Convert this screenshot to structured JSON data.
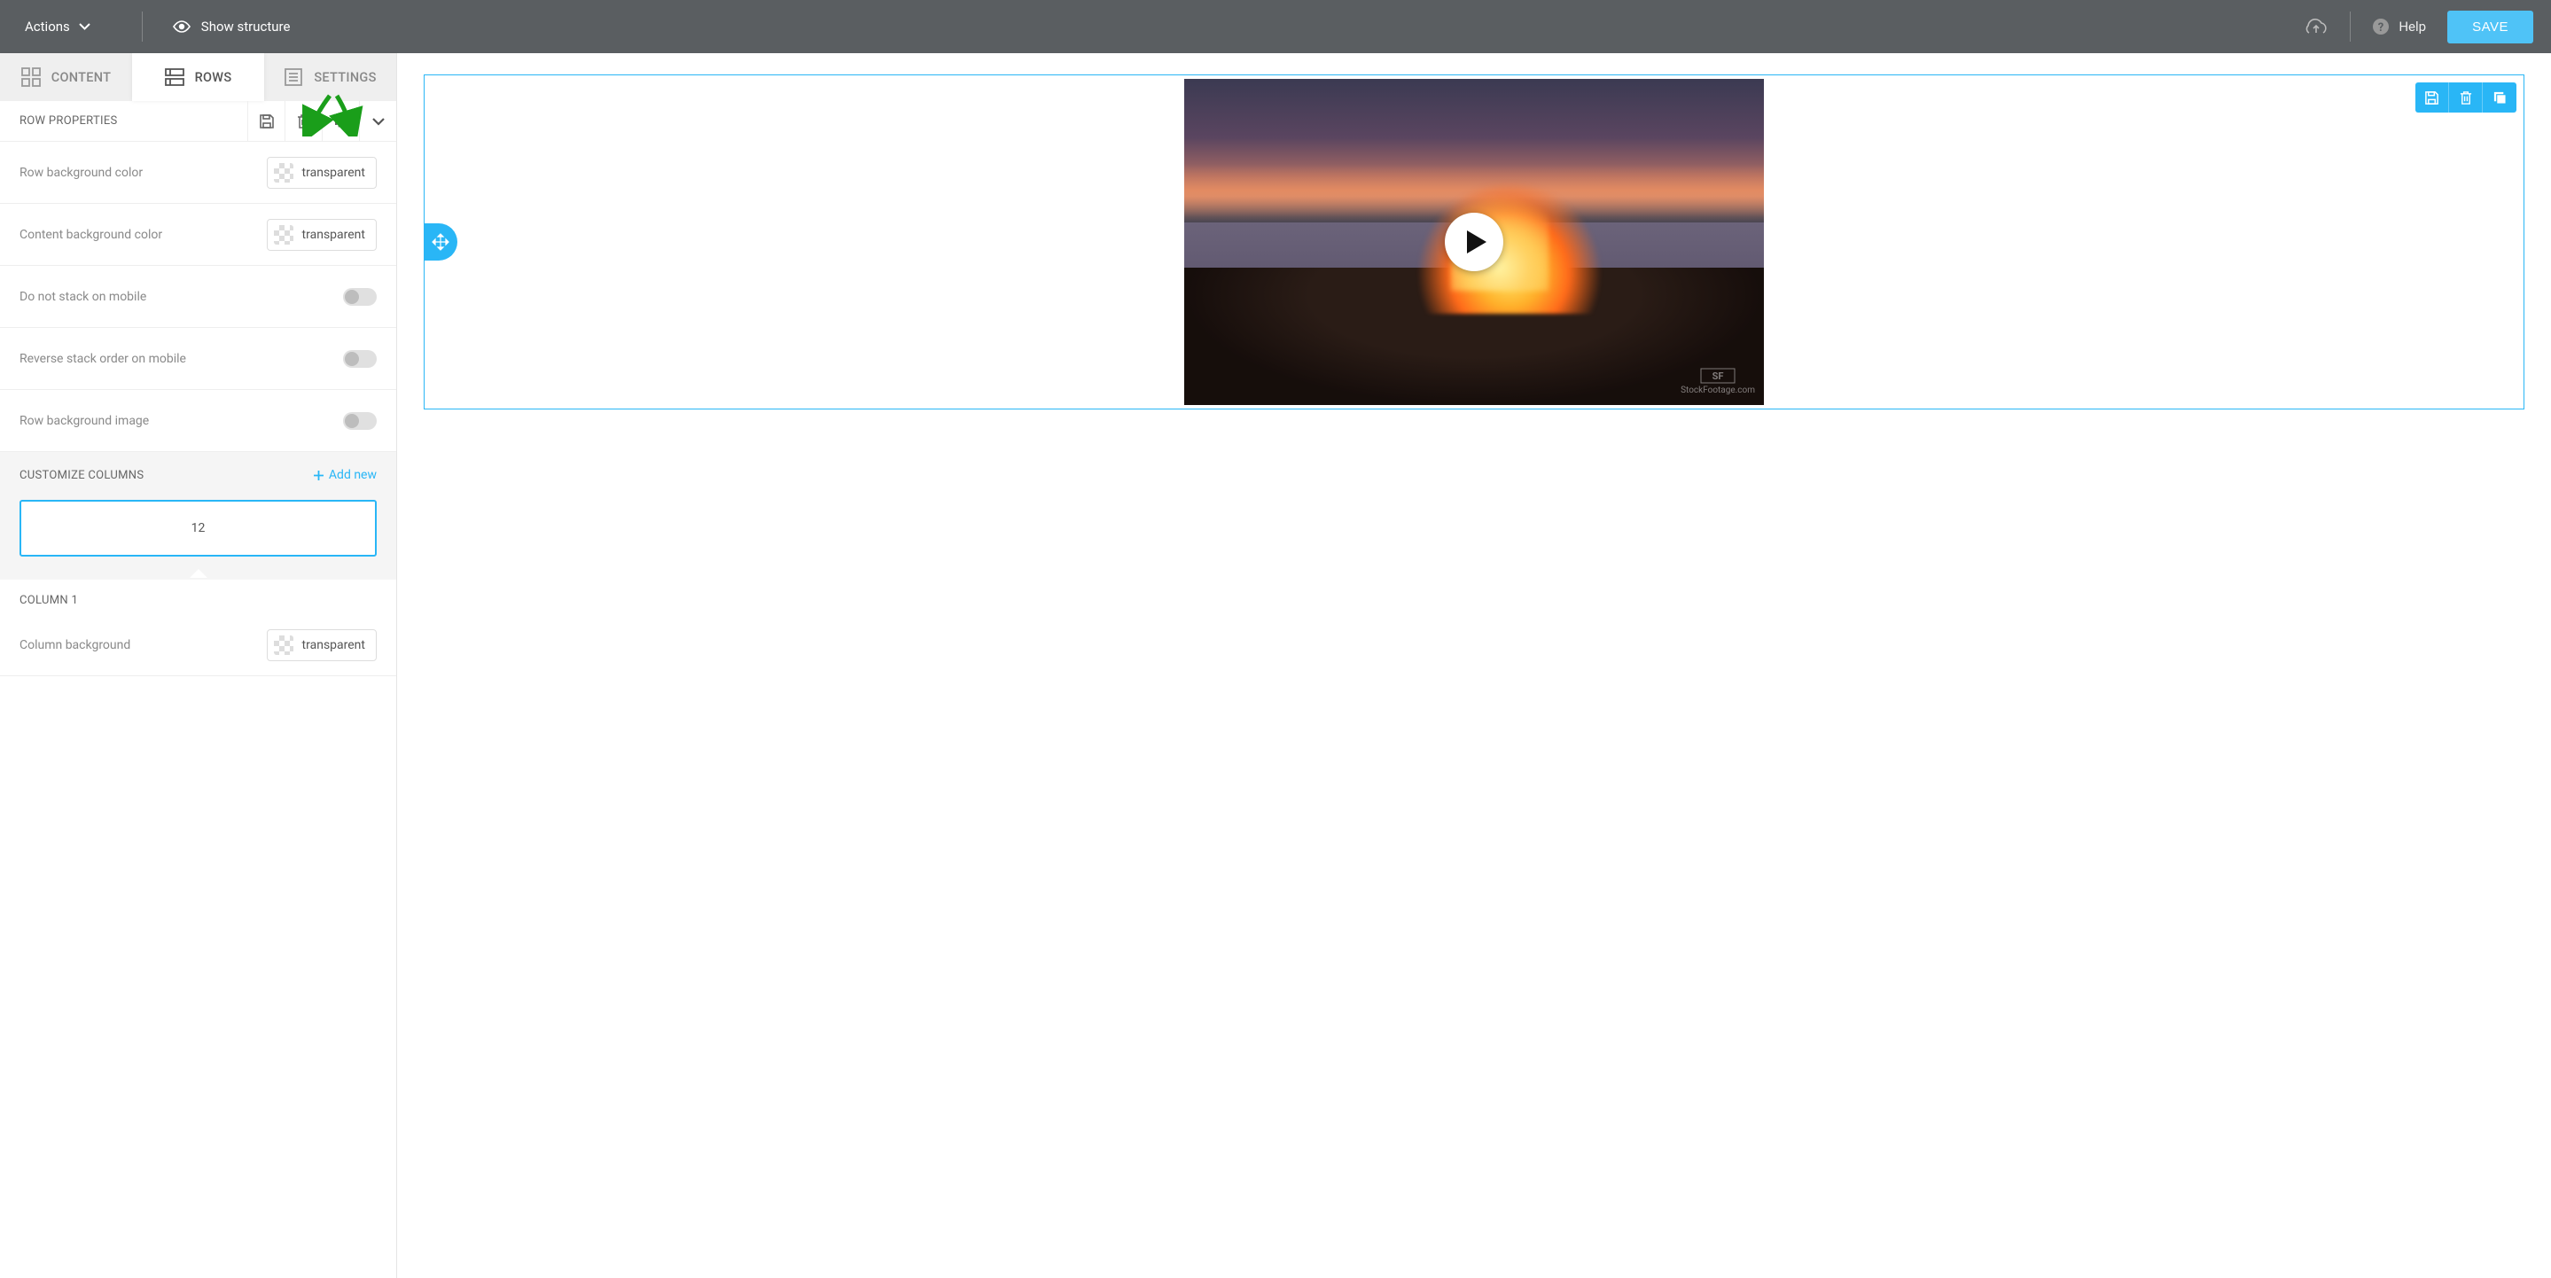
{
  "topbar": {
    "actions_label": "Actions",
    "show_structure_label": "Show structure",
    "help_label": "Help",
    "save_label": "SAVE"
  },
  "tabs": {
    "content": "CONTENT",
    "rows": "ROWS",
    "settings": "SETTINGS"
  },
  "panel": {
    "title": "ROW PROPERTIES"
  },
  "props": {
    "row_bg_color": {
      "label": "Row background color",
      "value": "transparent"
    },
    "content_bg_color": {
      "label": "Content background color",
      "value": "transparent"
    },
    "no_stack_mobile": {
      "label": "Do not stack on mobile"
    },
    "reverse_stack": {
      "label": "Reverse stack order on mobile"
    },
    "row_bg_image": {
      "label": "Row background image"
    }
  },
  "columns": {
    "section_title": "CUSTOMIZE COLUMNS",
    "add_new_label": "Add new",
    "value": "12",
    "column1_title": "COLUMN 1",
    "column_bg": {
      "label": "Column background",
      "value": "transparent"
    }
  },
  "canvas": {
    "watermark": "StockFootage.com"
  }
}
